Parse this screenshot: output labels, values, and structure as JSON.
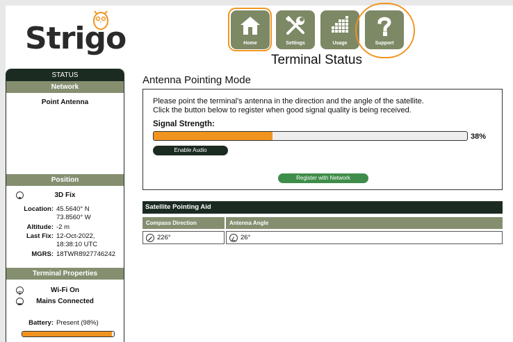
{
  "brand": {
    "name": "Strigo"
  },
  "nav": [
    {
      "label": "Home",
      "icon": "home-icon"
    },
    {
      "label": "Settings",
      "icon": "tools-icon"
    },
    {
      "label": "Usage",
      "icon": "usage-icon"
    },
    {
      "label": "Support",
      "icon": "question-icon"
    }
  ],
  "page_title": "Terminal Status",
  "sidebar": {
    "header": "STATUS",
    "network": {
      "title": "Network",
      "status": "Point Antenna"
    },
    "position": {
      "title": "Position",
      "fix": "3D Fix",
      "location_label": "Location:",
      "location_lat": "45.5640° N",
      "location_lon": "73.8560° W",
      "altitude_label": "Altitude:",
      "altitude": "-2 m",
      "lastfix_label": "Last Fix:",
      "lastfix_date": "12-Oct-2022,",
      "lastfix_time": "18:38:10 UTC",
      "mgrs_label": "MGRS:",
      "mgrs": "18TWR8927746242"
    },
    "terminal": {
      "title": "Terminal Properties",
      "wifi": "Wi-Fi On",
      "power": "Mains Connected",
      "battery_label": "Battery:",
      "battery_value": "Present (98%)",
      "battery_level": 0.98
    }
  },
  "main": {
    "mode_title": "Antenna Pointing Mode",
    "instruction_1": "Please point the terminal's antenna in the direction and the angle of the satellite.",
    "instruction_2": "Click the button below to register when good signal quality is being received.",
    "signal_label": "Signal Strength:",
    "signal_pct_text": "38%",
    "signal_level": 0.38,
    "enable_audio": "Enable Audio",
    "register": "Register with Network"
  },
  "aid": {
    "title": "Satellite Pointing Aid",
    "compass_header": "Compass Direction",
    "angle_header": "Antenna Angle",
    "compass_value": "226°",
    "angle_value": "26°"
  },
  "colors": {
    "accent": "#f0941f",
    "olive": "#858f70",
    "dark": "#1c2b22",
    "green": "#3f8d4a"
  }
}
